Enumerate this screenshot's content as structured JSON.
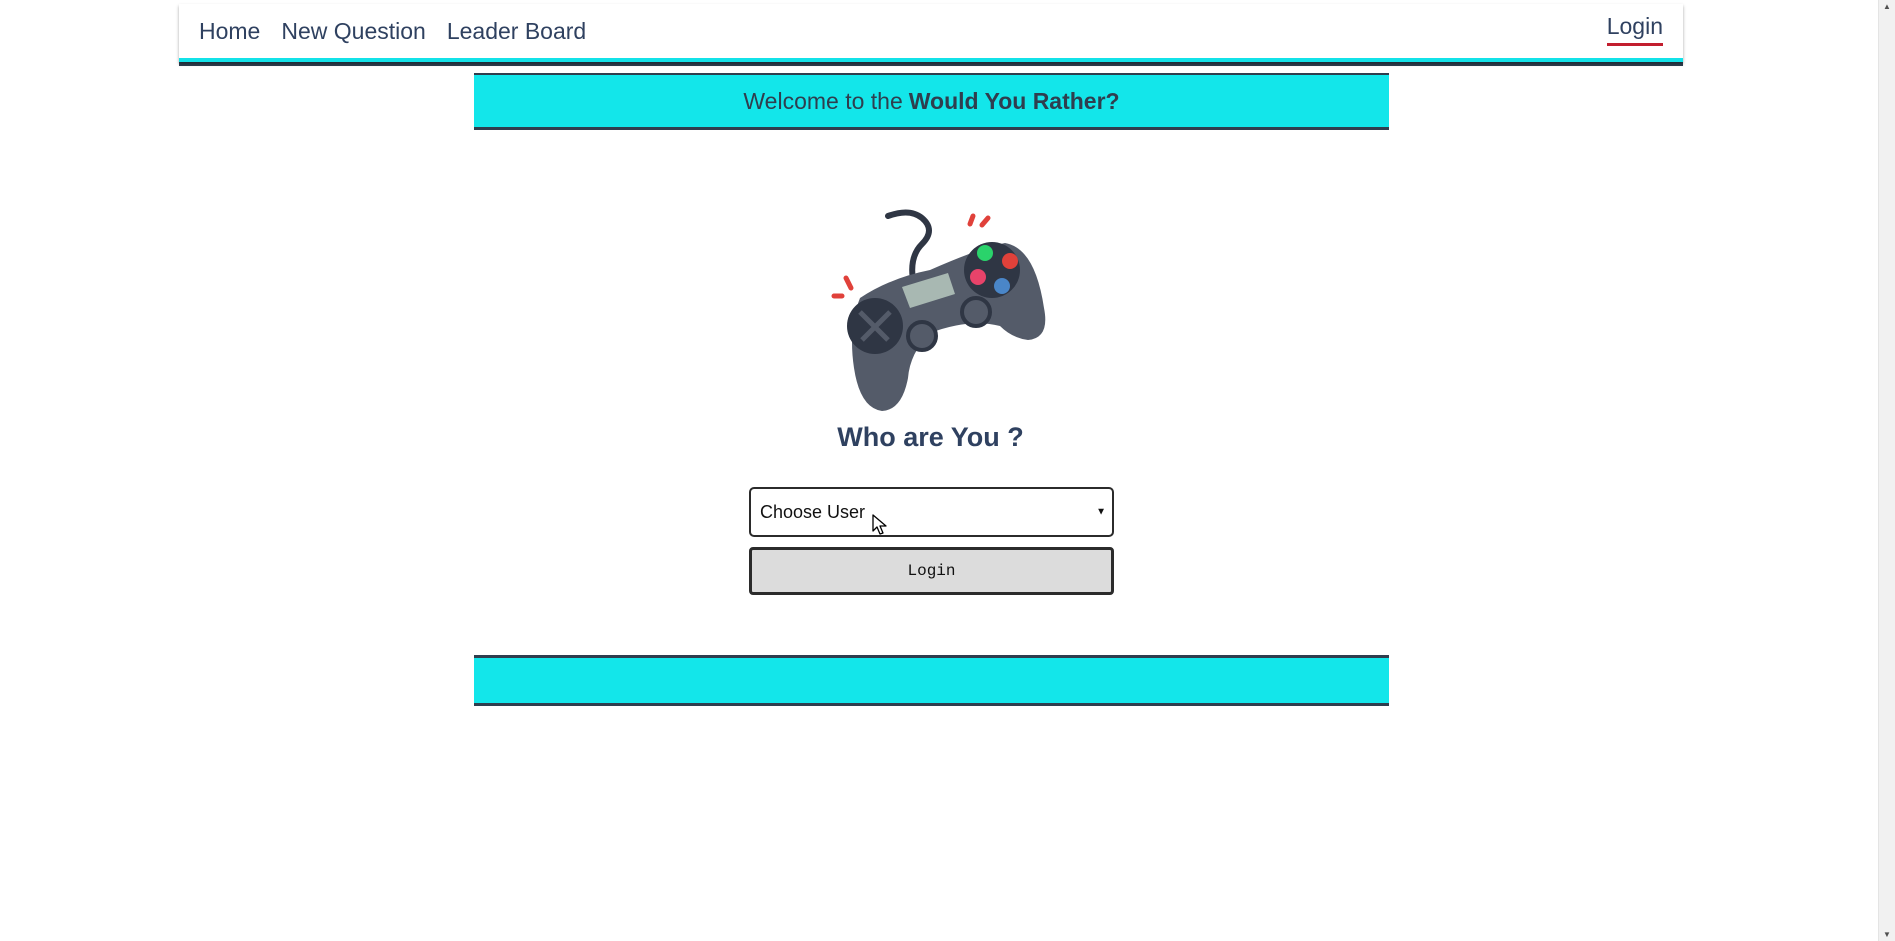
{
  "navbar": {
    "links": [
      {
        "label": "Home"
      },
      {
        "label": "New Question"
      },
      {
        "label": "Leader Board"
      }
    ],
    "login_label": "Login"
  },
  "banner": {
    "prefix": "Welcome to the",
    "app_name": "Would You Rather?"
  },
  "main": {
    "illustration": "gamepad-icon",
    "heading": "Who are You ?",
    "user_select": {
      "selected": "Choose User"
    },
    "login_button_label": "Login"
  },
  "colors": {
    "accent": "#13e6ea",
    "dark": "#2f3e4e",
    "text": "#2f4160",
    "login_underline": "#c21e2e"
  }
}
